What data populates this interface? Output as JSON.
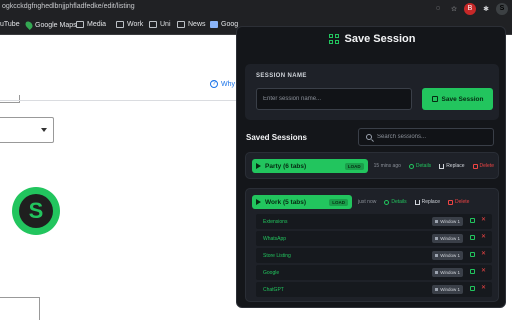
{
  "browser": {
    "url": "ogkcckdgfnghedlbnjjphfladfedke/edit/listing",
    "bookmarks": [
      {
        "label": "uTube",
        "icon": "youtube-icon"
      },
      {
        "label": "Google Maps",
        "icon": "maps-icon"
      },
      {
        "label": "Media",
        "icon": "folder-icon"
      },
      {
        "label": "Work",
        "icon": "folder-icon"
      },
      {
        "label": "Uni",
        "icon": "folder-icon"
      },
      {
        "label": "News",
        "icon": "folder-icon"
      },
      {
        "label": "Goog",
        "icon": "folder-icon"
      }
    ],
    "extension_letter": "S",
    "ext_red_letter": "B"
  },
  "page": {
    "why_label": "Why",
    "logo_letter": "S",
    "accent": "#22c55e"
  },
  "popup": {
    "title": "Save Session",
    "session_name_label": "SESSION NAME",
    "session_name_placeholder": "Enter session name...",
    "save_button": "Save Session",
    "saved_sessions_title": "Saved Sessions",
    "search_placeholder": "Search sessions...",
    "load_label": "LOAD",
    "details_label": "Details",
    "replace_label": "Replace",
    "delete_label": "Delete",
    "sessions": [
      {
        "name": "Party (6 tabs)",
        "time": "15 mins ago",
        "expanded": false,
        "tabs": []
      },
      {
        "name": "Work (5 tabs)",
        "time": "just now",
        "expanded": true,
        "tabs": [
          {
            "title": "Extensions",
            "window": "Window 1"
          },
          {
            "title": "WhatsApp",
            "window": "Window 1"
          },
          {
            "title": "Store Listing",
            "window": "Window 1"
          },
          {
            "title": "Google",
            "window": "Window 1"
          },
          {
            "title": "ChatGPT",
            "window": "Window 1"
          }
        ]
      }
    ],
    "colors": {
      "accent": "#22c55e",
      "danger": "#ef4444",
      "panel": "#14161a"
    }
  }
}
